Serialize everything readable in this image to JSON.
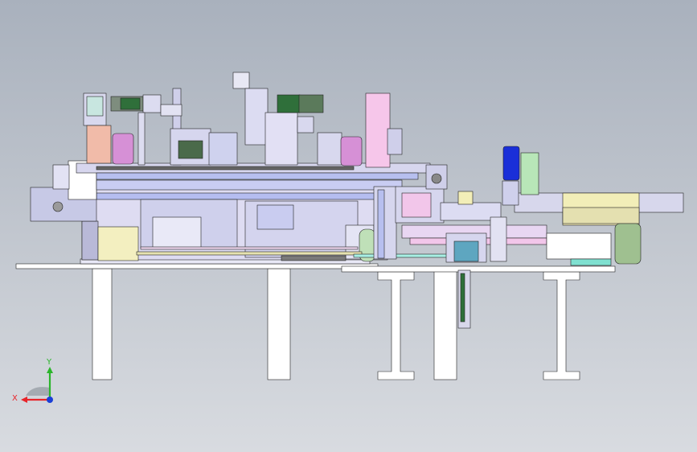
{
  "view": {
    "background_top": "#a9b1bd",
    "background_bottom": "#d8dbe0"
  },
  "triad": {
    "x_label": "X",
    "y_label": "Y",
    "x_color": "#e8242a",
    "y_color": "#2bb52b",
    "z_color": "#1a3fd6",
    "icon": "coordinate-triad-icon"
  },
  "colors": {
    "frame_lavender": "#d9d6f0",
    "frame_blue": "#aab6e8",
    "base_white": "#ffffff",
    "motor_green": "#2f6f3a",
    "cylinder_magenta": "#d890d8",
    "block_pink": "#f4c6e8",
    "block_salmon": "#f0b8a8",
    "block_yellow": "#f2eeb8",
    "accent_blue": "#1a2fd8",
    "mint": "#7fe0d0",
    "olive": "#9fc090"
  }
}
